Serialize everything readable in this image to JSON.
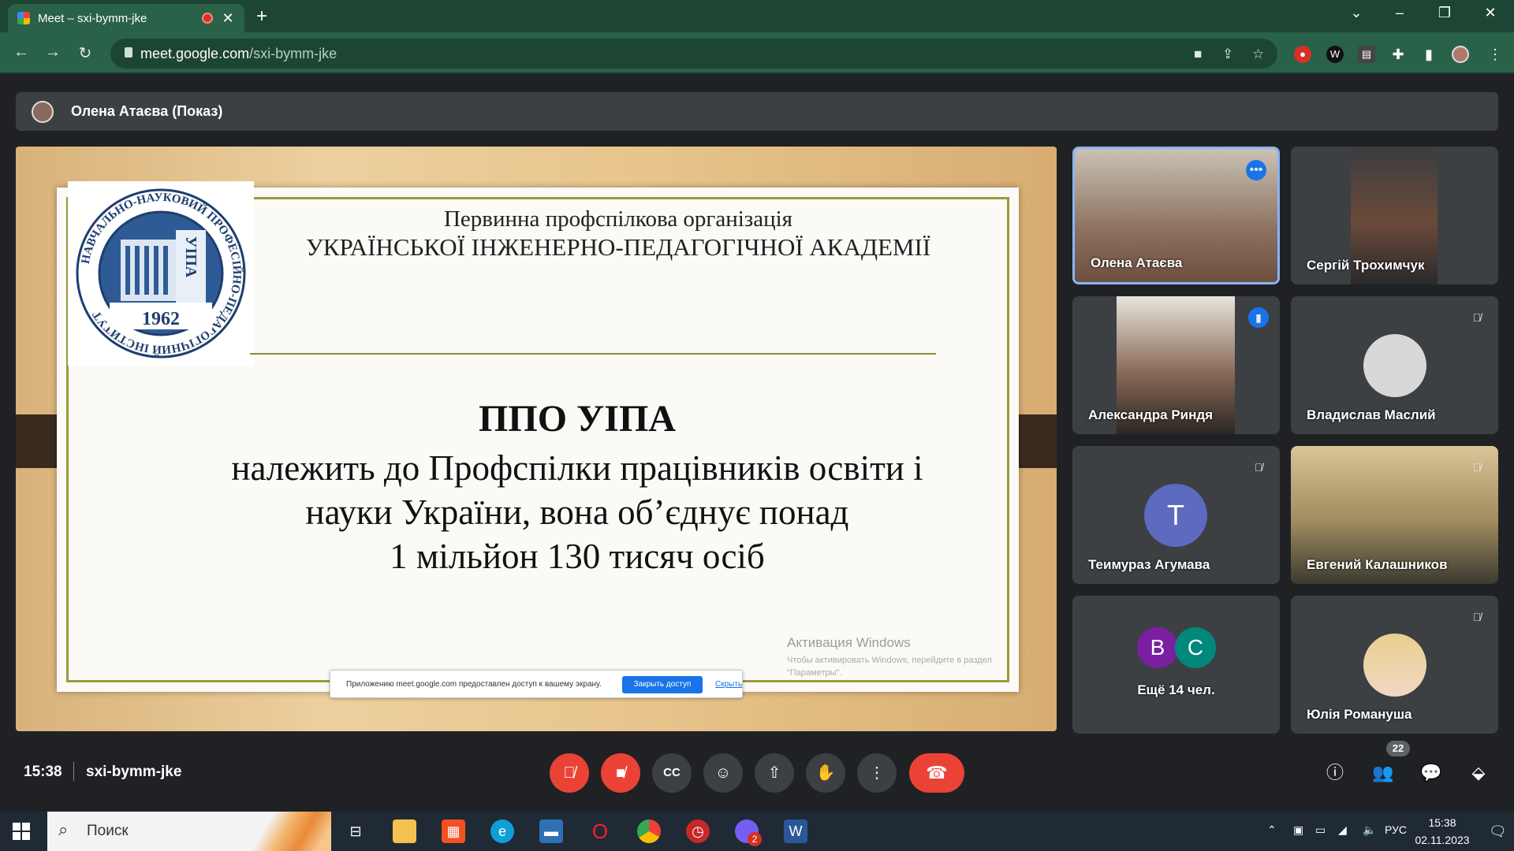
{
  "browser": {
    "tab_title": "Meet – sxi-bymm-jke",
    "url_host": "meet.google.com",
    "url_path": "/sxi-bymm-jke"
  },
  "meet": {
    "presenter_label": "Олена Атаєва (Показ)",
    "time": "15:38",
    "meeting_code": "sxi-bymm-jke",
    "participant_count": "22"
  },
  "slide": {
    "heading_line1": "Первинна профспілкова організація",
    "heading_line2": "УКРАЇНСЬКОЇ ІНЖЕНЕРНО-ПЕДАГОГІЧНОЇ АКАДЕМІЇ",
    "logo_ring_text": "НАВЧАЛЬНО-НАУКОВИЙ ПРОФЕСІЙНО-ПЕДАГОГІЧНИЙ ІНСТИТУТ",
    "logo_emblem": "УІПА",
    "logo_year": "1962",
    "main_title": "ППО УІПА",
    "body_line1": "належить до Профспілки працівників освіти і",
    "body_line2": "науки України, вона об’єднує понад",
    "body_line3": "1 мільйон 130 тисяч осіб",
    "watermark_title": "Активация Windows",
    "watermark_text": "Чтобы активировать Windows, перейдите в раздел \"Параметры\".",
    "share_notice": "Приложению meet.google.com предоставлен доступ к вашему экрану.",
    "share_stop": "Закрыть доступ",
    "share_hide": "Скрыть"
  },
  "participants": [
    {
      "name": "Олена Атаєва"
    },
    {
      "name": "Сергій Трохимчук"
    },
    {
      "name": "Александра Риндя"
    },
    {
      "name": "Владислав Маслий"
    },
    {
      "name": "Теимураз Агумава",
      "initial": "T"
    },
    {
      "name": "Евгений Калашников"
    },
    {
      "name": "Ещё 14 чел.",
      "initials": [
        "B",
        "C"
      ]
    },
    {
      "name": "Юлія Романуша"
    }
  ],
  "taskbar": {
    "search_placeholder": "Поиск",
    "lang": "РУС",
    "time": "15:38",
    "date": "02.11.2023",
    "viber_badge": "2"
  },
  "colors": {
    "meet_bg": "#202124",
    "tile_bg": "#3c4043",
    "danger": "#ea4335",
    "accent_blue": "#1a73e8",
    "browser_green": "#2a6149"
  }
}
